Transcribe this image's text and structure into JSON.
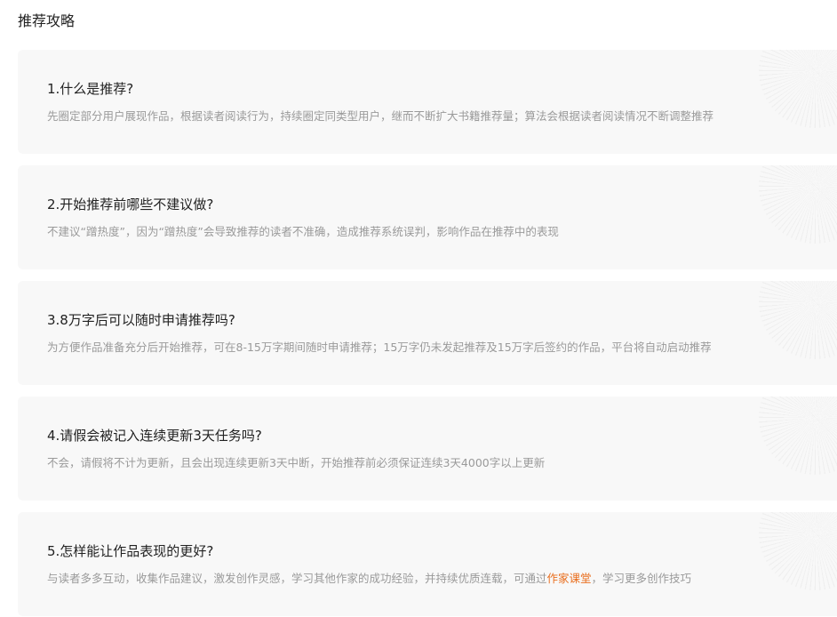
{
  "page": {
    "title": "推荐攻略"
  },
  "faq": [
    {
      "question": "1.什么是推荐?",
      "answer": "先圈定部分用户展现作品，根据读者阅读行为，持续圈定同类型用户，继而不断扩大书籍推荐量；算法会根据读者阅读情况不断调整推荐"
    },
    {
      "question": "2.开始推荐前哪些不建议做?",
      "answer": "不建议“蹭热度”，因为“蹭热度”会导致推荐的读者不准确，造成推荐系统误判，影响作品在推荐中的表现"
    },
    {
      "question": "3.8万字后可以随时申请推荐吗?",
      "answer": "为方便作品准备充分后开始推荐，可在8-15万字期间随时申请推荐；15万字仍未发起推荐及15万字后签约的作品，平台将自动启动推荐"
    },
    {
      "question": "4.请假会被记入连续更新3天任务吗?",
      "answer": "不会，请假将不计为更新，且会出现连续更新3天中断，开始推荐前必须保证连续3天4000字以上更新"
    },
    {
      "question": "5.怎样能让作品表现的更好?",
      "answer_before": "与读者多多互动，收集作品建议，激发创作灵感，学习其他作家的成功经验，并持续优质连载，可通过",
      "answer_link": "作家课堂",
      "answer_after": "，学习更多创作技巧"
    }
  ],
  "colors": {
    "link": "#e96f1f",
    "card_bg": "#f8f8f8",
    "question_text": "#222222",
    "answer_text": "#9a9a9a"
  }
}
